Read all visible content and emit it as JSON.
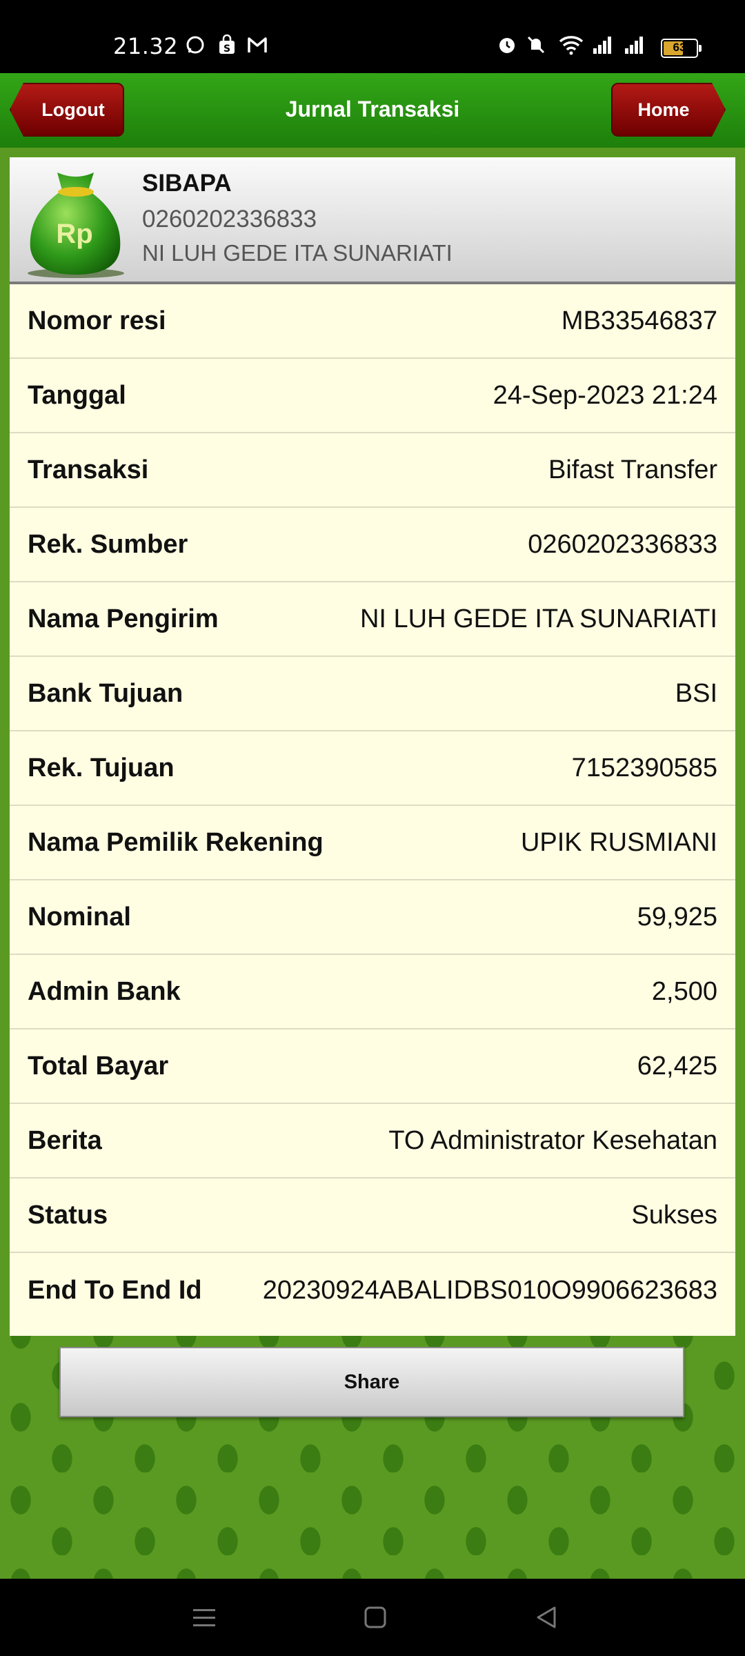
{
  "status_bar": {
    "time": "21.32",
    "battery": "63",
    "icons": [
      "whatsapp-icon",
      "shopping-bag-icon",
      "gmail-icon",
      "alarm-icon",
      "mute-icon",
      "wifi-icon",
      "signal-icon",
      "signal-icon-2",
      "battery-icon"
    ]
  },
  "header": {
    "title": "Jurnal Transaksi",
    "logout_label": "Logout",
    "home_label": "Home"
  },
  "account": {
    "name": "SIBAPA",
    "number": "0260202336833",
    "owner": "NI LUH GEDE ITA SUNARIATI",
    "logo_text": "Rp"
  },
  "rows": [
    {
      "label": "Nomor resi",
      "value": "MB33546837"
    },
    {
      "label": "Tanggal",
      "value": "24-Sep-2023 21:24"
    },
    {
      "label": "Transaksi",
      "value": "Bifast Transfer"
    },
    {
      "label": "Rek. Sumber",
      "value": "0260202336833"
    },
    {
      "label": "Nama Pengirim",
      "value": "NI LUH GEDE ITA SUNARIATI"
    },
    {
      "label": "Bank Tujuan",
      "value": "BSI"
    },
    {
      "label": "Rek. Tujuan",
      "value": "7152390585"
    },
    {
      "label": "Nama Pemilik Rekening",
      "value": "UPIK RUSMIANI"
    },
    {
      "label": "Nominal",
      "value": "59,925"
    },
    {
      "label": "Admin Bank",
      "value": "2,500"
    },
    {
      "label": "Total Bayar",
      "value": "62,425"
    },
    {
      "label": "Berita",
      "value": "TO Administrator Kesehatan"
    },
    {
      "label": "Status",
      "value": "Sukses"
    },
    {
      "label": "End To End Id",
      "value": "20230924ABALIDBS010O9906623683"
    }
  ],
  "share_label": "Share",
  "nav_bar": [
    "menu-icon",
    "home-square-icon",
    "back-triangle-icon"
  ]
}
